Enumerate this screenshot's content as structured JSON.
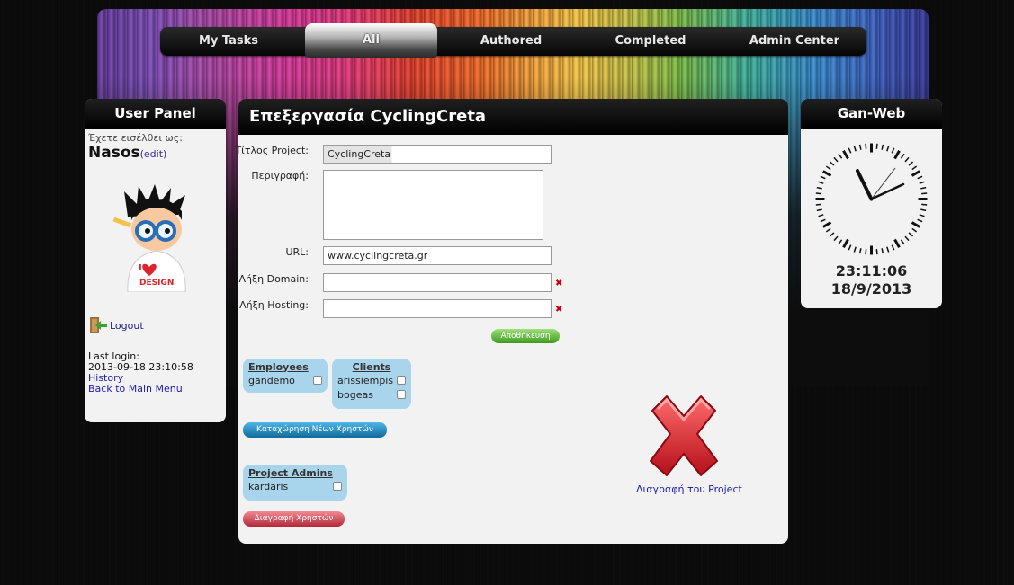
{
  "nav": {
    "items": [
      "My Tasks",
      "All",
      "Authored",
      "Completed",
      "Admin Center"
    ],
    "active_index": 1
  },
  "user_panel": {
    "title": "User Panel",
    "logged_as_label": "Έχετε εισέλθει ως:",
    "username": "Nasos",
    "edit_label": "(edit)",
    "logout_label": "Logout",
    "last_login_label": "Last login:",
    "last_login_value": "2013-09-18 23:10:58",
    "history_label": "History",
    "back_label": "Back to Main Menu",
    "avatar_text": "I ♥ DESIGN"
  },
  "main": {
    "title": "Επεξεργασία CyclingCreta",
    "fields": {
      "title_label": "Τίτλος Project:",
      "title_value": "CyclingCreta",
      "description_label": "Περιγραφή:",
      "url_label": "URL:",
      "url_value": "www.cyclingcreta.gr",
      "domain_label": "Λήξη Domain:",
      "hosting_label": "Λήξη Hosting:"
    },
    "save_label": "Αποθήκευση",
    "employees": {
      "title": "Employees",
      "items": [
        "gandemo"
      ]
    },
    "clients": {
      "title": "Clients",
      "items": [
        "arissiempis",
        "bogeas"
      ]
    },
    "add_users_label": "Καταχώρηση Νέων Χρηστών",
    "admins": {
      "title": "Project Admins",
      "items": [
        "kardaris"
      ]
    },
    "delete_users_label": "Διαγραφή Χρηστών",
    "delete_project_label": "Διαγραφή του Project"
  },
  "clock_panel": {
    "title": "Gan-Web",
    "time": "23:11:06",
    "date": "18/9/2013"
  },
  "colors": {
    "panel_bg": "#f2f2f2",
    "box_blue": "#a9d5ec",
    "save_green": "#4aa52a",
    "add_blue": "#1780b6",
    "delete_red": "#c23444",
    "link_blue": "#1c1cb0"
  }
}
